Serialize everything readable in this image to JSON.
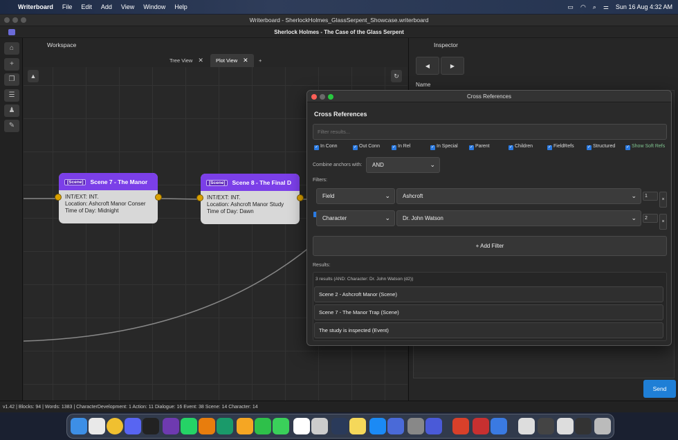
{
  "menubar": {
    "app": "Writerboard",
    "items": [
      "File",
      "Edit",
      "Add",
      "View",
      "Window",
      "Help"
    ],
    "datetime": "Sun 16 Aug  4:32 AM"
  },
  "window": {
    "title": "Writerboard - SherlockHolmes_GlassSerpent_Showcase.writerboard",
    "project_title": "Sherlock Holmes - The Case of the Glass Serpent"
  },
  "workspace": {
    "header": "Workspace",
    "tabs": [
      {
        "label": "Tree View"
      },
      {
        "label": "Plot View"
      }
    ],
    "add_tab": "+",
    "up_btn": "▲",
    "refresh_btn": "↻"
  },
  "nodes": [
    {
      "tag": "[Scene]",
      "title": "Scene 7 - The Manor",
      "lines": [
        "INT/EXT: INT.",
        "Location: Ashcroft Manor Conser",
        "Time of Day: Midnight"
      ]
    },
    {
      "tag": "[Scene]",
      "title": "Scene 8 - The Final D",
      "lines": [
        "INT/EXT: INT.",
        "Location: Ashcroft Manor Study",
        "Time of Day: Dawn"
      ]
    }
  ],
  "inspector": {
    "header": "Inspector",
    "prev": "◀",
    "next": "▶",
    "name_label": "Name",
    "send": "Send"
  },
  "cross_references": {
    "window_title": "Cross References",
    "heading": "Cross References",
    "filter_placeholder": "Filter results...",
    "checkboxes": [
      {
        "label": "In Conn",
        "checked": true
      },
      {
        "label": "Out Conn",
        "checked": true
      },
      {
        "label": "In Rel",
        "checked": true
      },
      {
        "label": "In Special",
        "checked": true
      },
      {
        "label": "Parent",
        "checked": true
      },
      {
        "label": "Children",
        "checked": true
      },
      {
        "label": "FieldRefs",
        "checked": true
      },
      {
        "label": "Structured",
        "checked": true
      },
      {
        "label": "Show Soft Refs",
        "checked": true
      }
    ],
    "combine_label": "Combine anchors with:",
    "combine_value": "AND",
    "filters_label": "Filters:",
    "filters": [
      {
        "field": "Field",
        "value": "Ashcroft",
        "count": "1"
      },
      {
        "field": "Character",
        "value": "Dr. John Watson",
        "count": "2"
      }
    ],
    "add_filter": "+ Add Filter",
    "results_label": "Results:",
    "results_summary": "3 results (AND: Character: Dr. John Watson (d2))",
    "results": [
      "Scene 2 - Ashcroft Manor (Scene)",
      "Scene 7 - The Manor Trap (Scene)",
      "The study is inspected (Event)"
    ]
  },
  "statusbar": {
    "text": "v1.42  |  Blocks: 94  |  Words: 1383  |  CharacterDevelopment: 1  Action: 11  Dialogue: 16  Event: 38  Scene: 14  Character: 14"
  }
}
